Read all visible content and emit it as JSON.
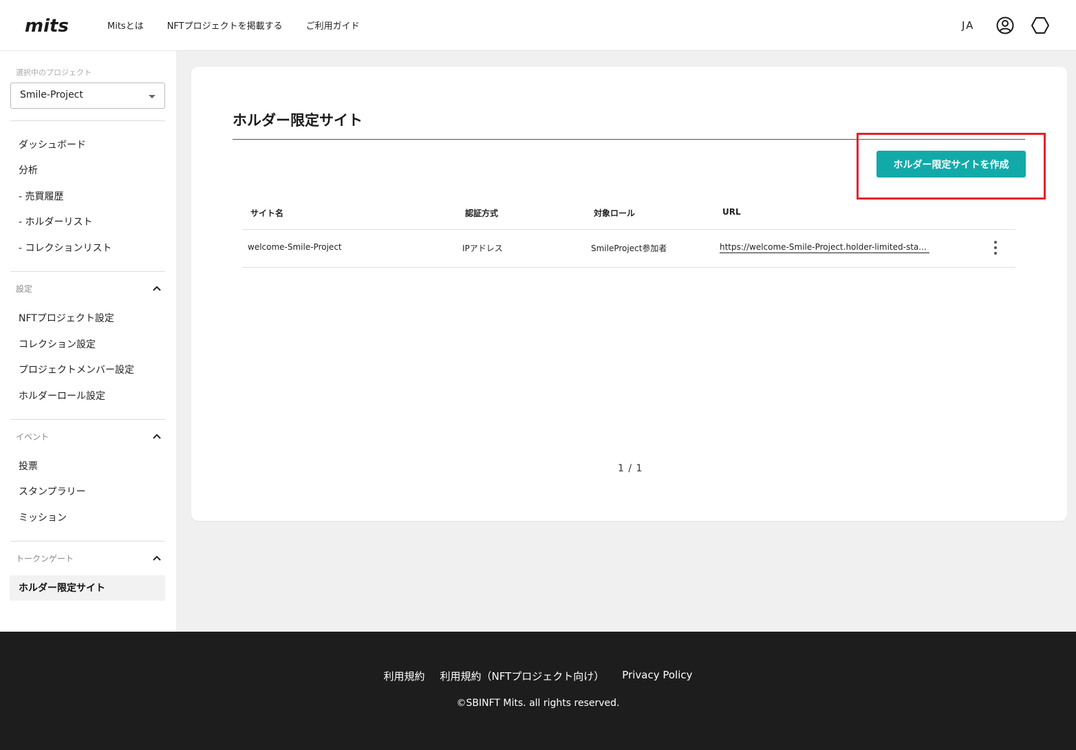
{
  "header": {
    "logo_text": "mits",
    "nav": [
      "Mitsとは",
      "NFTプロジェクトを掲載する",
      "ご利用ガイド"
    ],
    "lang": "JA"
  },
  "sidebar": {
    "selected_label": "選択中のプロジェクト",
    "selected_project": "Smile-Project",
    "items": [
      "ダッシュボード",
      "分析",
      "- 売買履歴",
      "- ホルダーリスト",
      "- コレクションリスト"
    ],
    "groups": [
      {
        "label": "設定",
        "items": [
          "NFTプロジェクト設定",
          "コレクション設定",
          "プロジェクトメンバー設定",
          "ホルダーロール設定"
        ]
      },
      {
        "label": "イベント",
        "items": [
          "投票",
          "スタンプラリー",
          "ミッション"
        ]
      },
      {
        "label": "トークンゲート",
        "items": [
          "ホルダー限定サイト"
        ]
      }
    ]
  },
  "main": {
    "title": "ホルダー限定サイト",
    "create_button": "ホルダー限定サイトを作成",
    "columns": [
      "サイト名",
      "認証方式",
      "対象ロール",
      "URL"
    ],
    "rows": [
      {
        "name": "welcome-Smile-Project",
        "auth": "IPアドレス",
        "role": "SmileProject参加者",
        "url": "https://welcome-Smile-Project.holder-limited-sta..."
      }
    ],
    "pagination": "1 / 1"
  },
  "footer": {
    "links": [
      "利用規約",
      "利用規約（NFTプロジェクト向け）",
      "Privacy Policy"
    ],
    "copyright": "©SBINFT Mits. all rights reserved."
  },
  "colors": {
    "accent": "#12aaa9",
    "highlight": "#e3202a",
    "footer_bg": "#1d1d1d"
  }
}
